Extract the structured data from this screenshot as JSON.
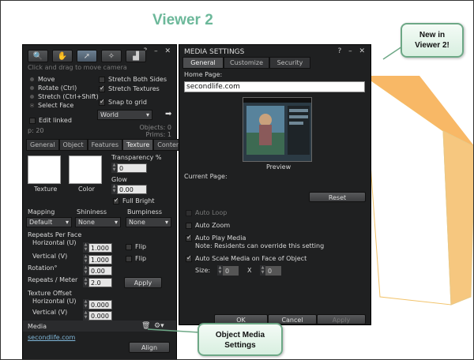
{
  "heading": "Viewer 2",
  "callouts": {
    "new_line1": "New in",
    "new_line2": "Viewer 2!",
    "media_line1": "Object Media",
    "media_line2": "Settings"
  },
  "tools": {
    "titlebar_icons": "? – ✕",
    "icons": [
      "focus-icon",
      "hand-icon",
      "pointer-icon",
      "wand-icon",
      "land-icon"
    ],
    "hint": "Click and drag to move camera",
    "modes": [
      {
        "label": "Move",
        "selected": false
      },
      {
        "label": "Rotate (Ctrl)",
        "selected": false
      },
      {
        "label": "Stretch (Ctrl+Shift)",
        "selected": false
      },
      {
        "label": "Select Face",
        "selected": true
      }
    ],
    "options": {
      "stretch_both": "Stretch Both Sides",
      "stretch_textures": "Stretch Textures",
      "snap_to_grid": "Snap to grid",
      "grid_dropdown": "World",
      "edit_linked": "Edit linked"
    },
    "counts": {
      "p": "p: 20",
      "objects": "Objects: 0",
      "prims": "Prims: 1"
    },
    "tabs": [
      "General",
      "Object",
      "Features",
      "Texture",
      "Content"
    ],
    "active_tab": "Texture",
    "texture": {
      "texture_label": "Texture",
      "color_label": "Color",
      "transparency_label": "Transparency %",
      "transparency_value": "0",
      "glow_label": "Glow",
      "glow_value": "0.00",
      "full_bright": "Full Bright",
      "mapping_label": "Mapping",
      "mapping_value": "Default",
      "shininess_label": "Shininess",
      "shininess_value": "None",
      "bumpiness_label": "Bumpiness",
      "bumpiness_value": "None",
      "repeats_per_face": "Repeats Per Face",
      "horizontal_u": "Horizontal (U)",
      "horizontal_u_value": "1.000",
      "vertical_v": "Vertical (V)",
      "vertical_v_value": "1.000",
      "flip": "Flip",
      "rotation_label": "Rotation°",
      "rotation_value": "0.00",
      "repeats_meter": "Repeats / Meter",
      "repeats_meter_value": "2.0",
      "apply": "Apply",
      "texture_offset": "Texture Offset",
      "offset_h_label": "Horizontal (U)",
      "offset_h_value": "0.000",
      "offset_v_label": "Vertical (V)",
      "offset_v_value": "0.000",
      "media_label": "Media",
      "media_url": "secondlife.com",
      "align": "Align"
    }
  },
  "media_settings": {
    "title": "MEDIA SETTINGS",
    "titlebar_icons": "? – ✕",
    "tabs": [
      "General",
      "Customize",
      "Security"
    ],
    "active_tab": "General",
    "home_page_label": "Home Page:",
    "home_page_value": "secondlife.com",
    "preview_label": "Preview",
    "current_page_label": "Current Page:",
    "reset": "Reset",
    "auto_loop": "Auto Loop",
    "auto_zoom": "Auto Zoom",
    "auto_play": "Auto Play Media",
    "auto_play_note": "Note: Residents can override this setting",
    "auto_scale": "Auto Scale Media on Face of Object",
    "size_label": "Size:",
    "size_x_value": "0",
    "size_sep": "X",
    "size_y_value": "0",
    "ok": "OK",
    "cancel": "Cancel",
    "apply": "Apply"
  }
}
